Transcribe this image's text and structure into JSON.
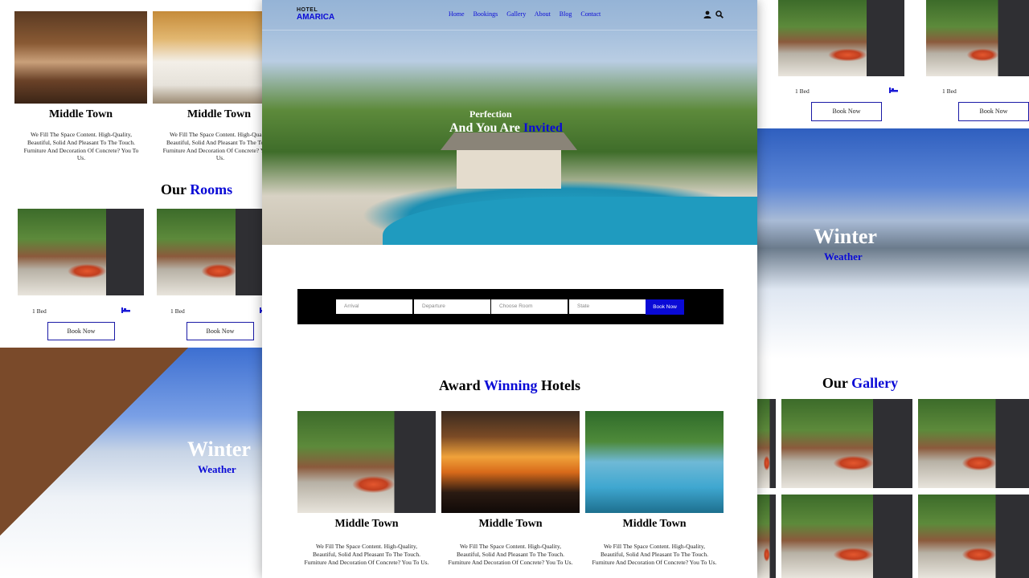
{
  "left_panel": {
    "cards": [
      {
        "title": "Middle Town",
        "desc": "We Fill The Space Content. High-Quality, Beautiful, Solid And Pleasant To The Touch. Furniture And Decoration Of Concrete? You To Us."
      },
      {
        "title": "Middle Town",
        "desc": "We Fill The Space Content. High-Quality, Beautiful, Solid And Pleasant To The Touch. Furniture And Decoration Of Concrete? You To Us."
      }
    ],
    "rooms_title_a": "Our",
    "rooms_title_b": "Rooms",
    "rooms": [
      {
        "beds": "1 Bed",
        "button": "Book Now"
      },
      {
        "beds": "1 Bed",
        "button": "Book Now"
      }
    ],
    "winter_title": "Winter",
    "winter_sub": "Weather"
  },
  "center_panel": {
    "brand_top": "HOTEL",
    "brand_main": "AMARICA",
    "nav": [
      "Home",
      "Bookings",
      "Gallery",
      "About",
      "Blog",
      "Contact"
    ],
    "hero_line1": "Perfection",
    "hero_line2a": "And You Are",
    "hero_line2b": "Invited",
    "booking": {
      "fields": [
        "Arrival",
        "Departure",
        "Choose Room",
        "State"
      ],
      "button": "Book Now"
    },
    "award_a": "Award",
    "award_b": "Winning",
    "award_c": "Hotels",
    "hotels": [
      {
        "title": "Middle Town",
        "desc": "We Fill The Space Content. High-Quality, Beautiful, Solid And Pleasant To The Touch. Furniture And Decoration Of Concrete? You To Us."
      },
      {
        "title": "Middle Town",
        "desc": "We Fill The Space Content. High-Quality, Beautiful, Solid And Pleasant To The Touch. Furniture And Decoration Of Concrete? You To Us."
      },
      {
        "title": "Middle Town",
        "desc": "We Fill The Space Content. High-Quality, Beautiful, Solid And Pleasant To The Touch. Furniture And Decoration Of Concrete? You To Us."
      }
    ]
  },
  "right_panel": {
    "rooms": [
      {
        "beds": "1 Bed",
        "button": "Book Now"
      },
      {
        "beds": "1 Bed",
        "button": "Book Now"
      }
    ],
    "winter_title": "Winter",
    "winter_sub": "Weather",
    "gallery_a": "Our",
    "gallery_b": "Gallery"
  },
  "colors": {
    "accent": "#0a0ad6",
    "booking_bar": "#000000"
  }
}
